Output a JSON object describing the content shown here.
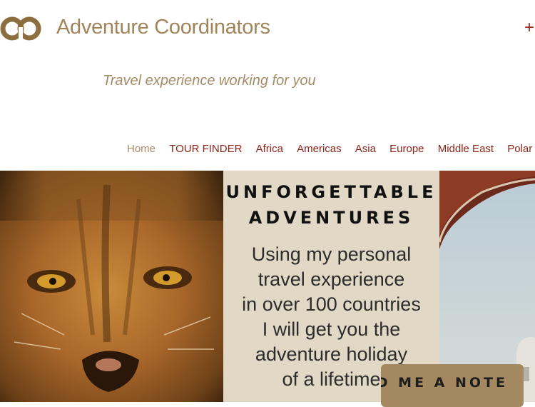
{
  "header": {
    "title": "Adventure Coordinators",
    "tagline": "Travel experience working for you",
    "plus_symbol": "+"
  },
  "nav": {
    "items": [
      "Home",
      "TOUR FINDER",
      "Africa",
      "Americas",
      "Asia",
      "Europe",
      "Middle East",
      "Polar"
    ],
    "active": "Home"
  },
  "hero": {
    "headline_line1": "UNFORGETTABLE",
    "headline_line2": "ADVENTURES",
    "body_lines": [
      "Using my personal",
      "travel experience",
      "in over 100 countries",
      "I will get you the",
      "adventure holiday",
      "of a lifetime"
    ]
  },
  "cta": {
    "label": "SEND ME A NOTE"
  },
  "colors": {
    "brand": "#a28459",
    "nav_link": "#8f2419",
    "panel_bg": "#e1d8c5",
    "button_bg": "#a48860"
  },
  "icons": [
    "logo-rings-icon",
    "plus-icon"
  ]
}
